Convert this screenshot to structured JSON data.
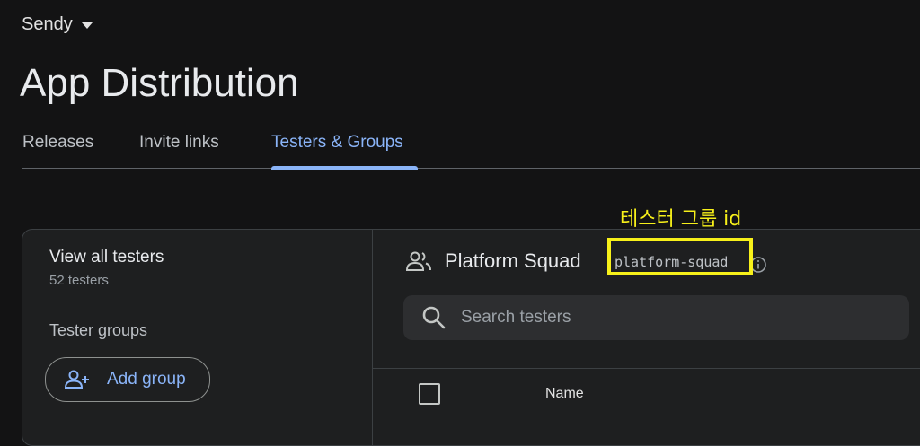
{
  "project": {
    "name": "Sendy"
  },
  "page": {
    "title": "App Distribution"
  },
  "tabs": [
    {
      "label": "Releases",
      "active": false
    },
    {
      "label": "Invite links",
      "active": false
    },
    {
      "label": "Testers & Groups",
      "active": true
    }
  ],
  "annotation": {
    "text": "테스터 그룹 id",
    "color": "#f7f01a"
  },
  "sidebar": {
    "view_all": "View all testers",
    "count": "52 testers",
    "groups_label": "Tester groups",
    "add_group": "Add group"
  },
  "group": {
    "name": "Platform Squad",
    "id": "platform-squad"
  },
  "search": {
    "placeholder": "Search testers"
  },
  "table": {
    "columns": [
      "Name"
    ]
  },
  "colors": {
    "accent": "#8ab4f8",
    "background": "#131314",
    "highlight": "#f7f01a"
  }
}
